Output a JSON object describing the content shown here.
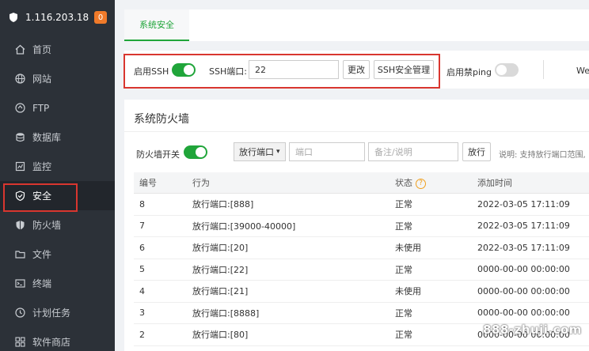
{
  "sidebar": {
    "server_ip": "1.116.203.18",
    "badge_count": "0",
    "items": [
      {
        "label": "首页",
        "icon": "home-icon"
      },
      {
        "label": "网站",
        "icon": "globe-icon"
      },
      {
        "label": "FTP",
        "icon": "ftp-icon"
      },
      {
        "label": "数据库",
        "icon": "database-icon"
      },
      {
        "label": "监控",
        "icon": "monitor-icon"
      },
      {
        "label": "安全",
        "icon": "shield-check-icon"
      },
      {
        "label": "防火墙",
        "icon": "firewall-shield-icon"
      },
      {
        "label": "文件",
        "icon": "folder-icon"
      },
      {
        "label": "终端",
        "icon": "terminal-icon"
      },
      {
        "label": "计划任务",
        "icon": "clock-icon"
      },
      {
        "label": "软件商店",
        "icon": "apps-grid-icon"
      }
    ]
  },
  "tabs": {
    "system_security": "系统安全"
  },
  "ssh": {
    "enable_label": "启用SSH",
    "enabled": true,
    "port_label": "SSH端口:",
    "port_value": "22",
    "change_button": "更改",
    "manage_button": "SSH安全管理",
    "ping_label": "启用禁ping",
    "ping_enabled": false,
    "truncated_right": "We"
  },
  "firewall": {
    "title": "系统防火墙",
    "switch_label": "防火墙开关",
    "switch_enabled": true,
    "rule_type": "放行端口",
    "port_placeholder": "端口",
    "note_placeholder": "备注/说明",
    "allow_button": "放行",
    "hint": "说明: 支持放行端口范围,",
    "columns": [
      "编号",
      "行为",
      "状态",
      "添加时间"
    ],
    "rows": [
      {
        "id": "8",
        "action": "放行端口:[888]",
        "status": "正常",
        "time": "2022-03-05 17:11:09"
      },
      {
        "id": "7",
        "action": "放行端口:[39000-40000]",
        "status": "正常",
        "time": "2022-03-05 17:11:09"
      },
      {
        "id": "6",
        "action": "放行端口:[20]",
        "status": "未使用",
        "time": "2022-03-05 17:11:09"
      },
      {
        "id": "5",
        "action": "放行端口:[22]",
        "status": "正常",
        "time": "0000-00-00 00:00:00"
      },
      {
        "id": "4",
        "action": "放行端口:[21]",
        "status": "未使用",
        "time": "0000-00-00 00:00:00"
      },
      {
        "id": "3",
        "action": "放行端口:[8888]",
        "status": "正常",
        "time": "0000-00-00 00:00:00"
      },
      {
        "id": "2",
        "action": "放行端口:[80]",
        "status": "正常",
        "time": "0000-00-00 00:00:00"
      }
    ]
  },
  "watermark": "888-zhuji.com",
  "colors": {
    "accent_green": "#20a53a",
    "sidebar_bg": "#2c3138",
    "highlight_red": "#d9362f",
    "badge_orange": "#f07a2a"
  }
}
